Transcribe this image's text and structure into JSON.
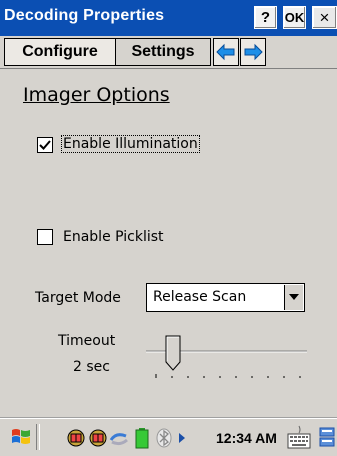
{
  "window": {
    "title": "Decoding Properties",
    "help_label": "?",
    "ok_label": "OK",
    "close_label": "×"
  },
  "tabs": {
    "items": [
      {
        "label": "Configure"
      },
      {
        "label": "Settings"
      }
    ],
    "prev_icon": "arrow-left-icon",
    "next_icon": "arrow-right-icon"
  },
  "content": {
    "section_title": "Imager Options",
    "enable_illumination": {
      "label": "Enable Illumination",
      "checked": true
    },
    "enable_picklist": {
      "label": "Enable Picklist",
      "checked": false
    },
    "target_mode": {
      "label": "Target Mode",
      "value": "Release Scan"
    },
    "timeout": {
      "label": "Timeout",
      "value_text": "2 sec",
      "level": 0.2
    }
  },
  "taskbar": {
    "start_icon": "windows-flag-icon",
    "tray_icons": [
      "network-icon",
      "network-icon",
      "sync-icon",
      "battery-icon",
      "bluetooth-icon"
    ],
    "time": "12:34 AM",
    "keyboard_icon": "keyboard-icon",
    "extra_icon": "window-switch-icon"
  },
  "colors": {
    "titlebar": "#0b4fb3",
    "arrow": "#1d8fe8",
    "background": "#d6d3ce"
  }
}
